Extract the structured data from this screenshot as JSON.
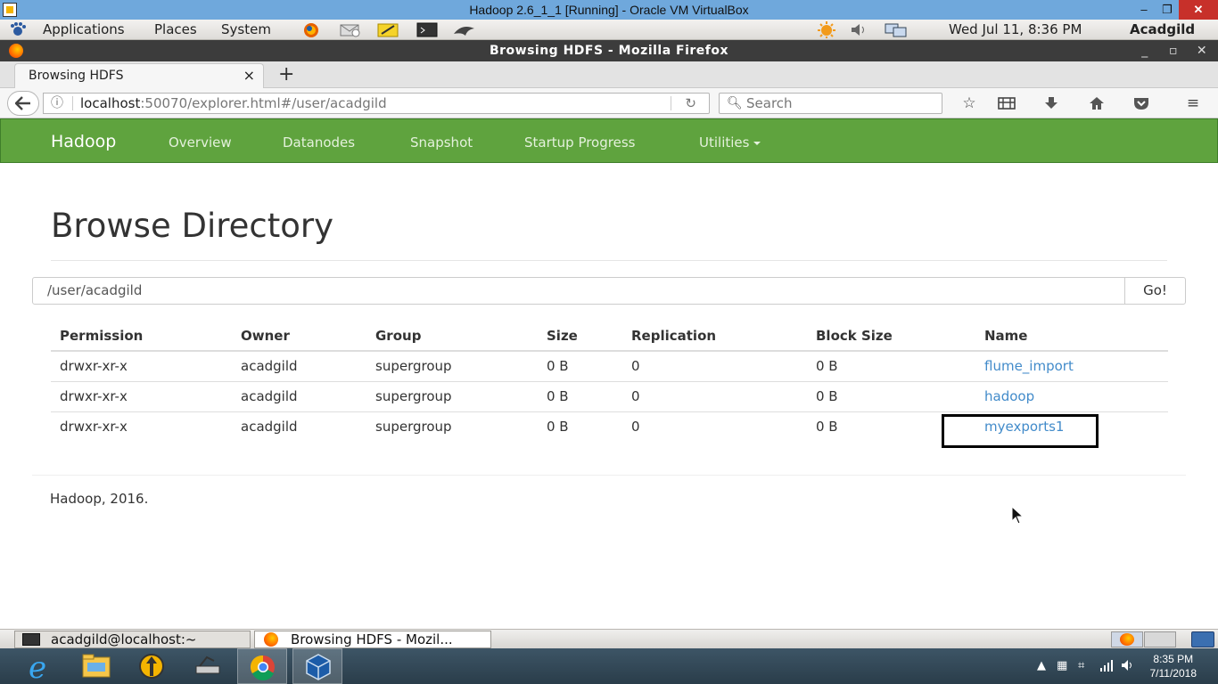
{
  "vbox": {
    "title": "Hadoop 2.6_1_1 [Running] - Oracle VM VirtualBox",
    "min": "–",
    "max": "❐",
    "close": "✕"
  },
  "gnome_panel": {
    "applications": "Applications",
    "places": "Places",
    "system": "System",
    "datetime": "Wed Jul 11,  8:36 PM",
    "user": "Acadgild"
  },
  "firefox": {
    "window_title": "Browsing HDFS - Mozilla Firefox",
    "tab_title": "Browsing HDFS",
    "url_host": "localhost",
    "url_rest": ":50070/explorer.html#/user/acadgild",
    "search_placeholder": "Search"
  },
  "hadoop_nav": {
    "brand": "Hadoop",
    "items": [
      "Overview",
      "Datanodes",
      "Snapshot",
      "Startup Progress",
      "Utilities"
    ]
  },
  "page": {
    "title": "Browse Directory",
    "path_value": "/user/acadgild",
    "go_label": "Go!",
    "footer": "Hadoop, 2016."
  },
  "table": {
    "headers": [
      "Permission",
      "Owner",
      "Group",
      "Size",
      "Replication",
      "Block Size",
      "Name"
    ],
    "rows": [
      [
        "drwxr-xr-x",
        "acadgild",
        "supergroup",
        "0 B",
        "0",
        "0 B",
        "flume_import"
      ],
      [
        "drwxr-xr-x",
        "acadgild",
        "supergroup",
        "0 B",
        "0",
        "0 B",
        "hadoop"
      ],
      [
        "drwxr-xr-x",
        "acadgild",
        "supergroup",
        "0 B",
        "0",
        "0 B",
        "myexports1"
      ]
    ]
  },
  "gnome_bottom": {
    "tasks": [
      "acadgild@localhost:~",
      "Browsing HDFS - Mozil..."
    ]
  },
  "windows": {
    "time": "8:35 PM",
    "date": "7/11/2018"
  },
  "colors": {
    "hadoop_green": "#5fa33e",
    "link_blue": "#428bca"
  }
}
